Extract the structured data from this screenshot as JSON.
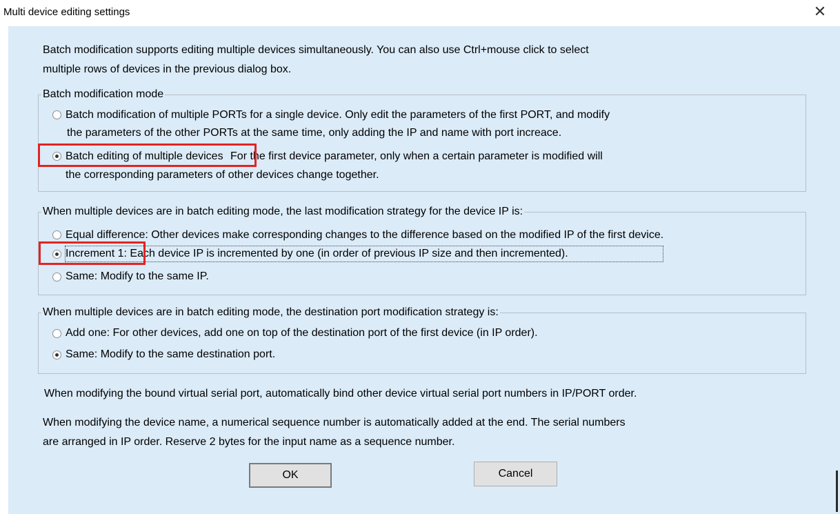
{
  "window": {
    "title": "Multi device editing settings",
    "close_glyph": "✕"
  },
  "intro": {
    "line1": "Batch modification supports editing multiple devices simultaneously. You can also use Ctrl+mouse click to select",
    "line2": "multiple rows of devices in the previous dialog box."
  },
  "batch_mode": {
    "legend": "Batch modification mode",
    "options": [
      {
        "label_line1": "Batch modification of multiple PORTs for a single device. Only edit the parameters of the first PORT, and modify",
        "label_line2": "the parameters of the other PORTs at the same time, only adding the IP and name with port increace.",
        "checked": false
      },
      {
        "label_prefix": "Batch editing of multiple devices",
        "label_rest": "For the first device parameter, only when a certain parameter is modified will",
        "label_line2": "the corresponding parameters of other devices change together.",
        "checked": true
      }
    ]
  },
  "ip_strategy": {
    "legend": "When multiple devices are in batch editing mode, the last modification strategy for the device IP is:",
    "options": [
      {
        "label": "Equal difference: Other devices make corresponding changes to the difference based on the modified IP of the first device.",
        "checked": false
      },
      {
        "label_prefix": "Increment 1:",
        "label_rest": "Each device IP is incremented by one (in order of previous IP size and then incremented).",
        "checked": true
      },
      {
        "label": "Same: Modify to the same IP.",
        "checked": false
      }
    ]
  },
  "port_strategy": {
    "legend": "When multiple devices are in batch editing mode, the destination port modification strategy is:",
    "options": [
      {
        "label": "Add one: For other devices, add one on top of the destination port of the first device (in IP order).",
        "checked": false
      },
      {
        "label": "Same: Modify to the same destination port.",
        "checked": true
      }
    ]
  },
  "notes": {
    "serial": "When modifying the bound virtual serial port, automatically bind other device virtual serial port numbers in IP/PORT order.",
    "name_line1": "When modifying the device name, a numerical sequence number is automatically added at the end. The serial numbers",
    "name_line2": "are arranged in IP order. Reserve 2 bytes for the input name as a sequence number."
  },
  "buttons": {
    "ok": "OK",
    "cancel": "Cancel"
  },
  "colors": {
    "client_bg": "#dbebf8",
    "highlight": "#e02424"
  }
}
